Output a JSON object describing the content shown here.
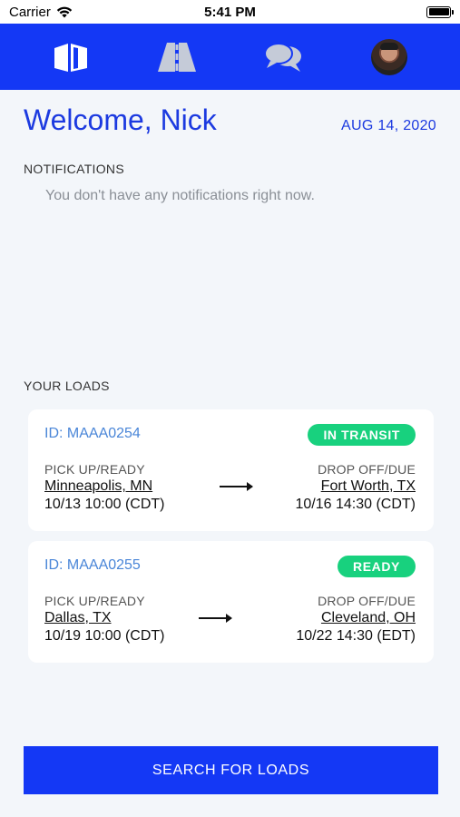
{
  "status_bar": {
    "carrier": "Carrier",
    "time": "5:41 PM"
  },
  "nav": {
    "items": [
      {
        "name": "loads-box-icon"
      },
      {
        "name": "road-icon"
      },
      {
        "name": "chat-icon"
      },
      {
        "name": "profile-avatar"
      }
    ]
  },
  "header": {
    "welcome": "Welcome, Nick",
    "date": "AUG 14, 2020"
  },
  "notifications": {
    "label": "NOTIFICATIONS",
    "empty_message": "You don't have any notifications right now."
  },
  "loads": {
    "label": "YOUR LOADS",
    "items": [
      {
        "id": "ID: MAAA0254",
        "status": "IN TRANSIT",
        "pickup_label": "PICK UP/READY",
        "pickup_city": "Minneapolis, MN",
        "pickup_time": "10/13 10:00 (CDT)",
        "drop_label": "DROP OFF/DUE",
        "drop_city": "Fort Worth, TX",
        "drop_time": "10/16 14:30 (CDT)"
      },
      {
        "id": "ID: MAAA0255",
        "status": "READY",
        "pickup_label": "PICK UP/READY",
        "pickup_city": "Dallas, TX",
        "pickup_time": "10/19 10:00 (CDT)",
        "drop_label": "DROP OFF/DUE",
        "drop_city": "Cleveland, OH",
        "drop_time": "10/22 14:30 (EDT)"
      }
    ]
  },
  "search_button": "SEARCH FOR LOADS",
  "colors": {
    "brand_blue": "#1438f5",
    "status_green": "#18d17e",
    "id_blue": "#4a86d8"
  }
}
